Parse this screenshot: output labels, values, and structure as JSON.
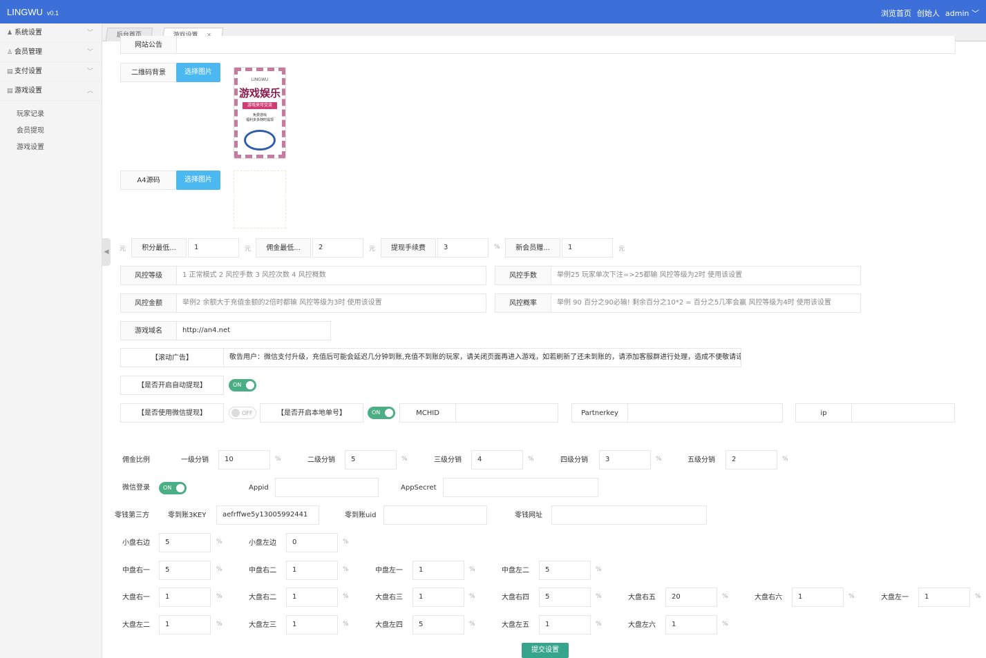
{
  "header": {
    "brand": "LINGWU",
    "version": "v0.1",
    "nav": [
      "浏览首页",
      "创始人",
      "admin"
    ],
    "accent": "#3c6fd8"
  },
  "sidebar": {
    "menus": [
      {
        "label": "系统设置",
        "icon": "person-icon",
        "arrow": "﹀"
      },
      {
        "label": "会员管理",
        "icon": "user-icon",
        "arrow": "﹀"
      },
      {
        "label": "支付设置",
        "icon": "card-icon",
        "arrow": "﹀"
      },
      {
        "label": "游戏设置",
        "icon": "card-icon",
        "arrow": "︿"
      }
    ],
    "submenus": [
      "玩家记录",
      "会员提现",
      "游戏设置"
    ]
  },
  "tabs": {
    "home": "后台首页",
    "game": "游戏设置",
    "close": "×"
  },
  "form": {
    "notice_label": "网站公告",
    "qr_label": "二维码背景",
    "choose_image": "选择图片",
    "a4_label": "A4源码",
    "poster": {
      "brand": "LINGWU",
      "title": "游戏娱乐",
      "banner": "游戏来可交流",
      "line1": "免费游戏",
      "line2": "福利多多随时提现"
    },
    "yuan": "元",
    "percent": "%",
    "min_points_label": "积分最低...",
    "min_points": "1",
    "min_commission_label": "佣金最低...",
    "min_commission": "2",
    "withdraw_fee_label": "提现手续费",
    "withdraw_fee": "3",
    "new_member_label": "新会员赠...",
    "new_member": "1",
    "risk_level_label": "风控等级",
    "risk_level_ph": "1 正常模式 2 风控手数 3 风控次数 4 风控概数",
    "risk_hands_label": "风控手数",
    "risk_hands_ph": "举例25 玩家单次下注=>25都输 风控等级为2时 使用该设置",
    "risk_amount_label": "风控金额",
    "risk_amount_ph": "举例2 余额大于充值金额的2倍时都输 风控等级为3时 使用该设置",
    "risk_prob_label": "风控概率",
    "risk_prob_ph": "举例 90 百分之90必输! 剩余百分之10*2 = 百分之5几率会赢 风控等级为4时 使用该设置",
    "domain_label": "游戏域名",
    "domain": "http://an4.net",
    "scroll_ad_label": "【滚动广告】",
    "scroll_ad": "敬告用户：微信支付升级，充值后可能会延迟几分钟到账,充值不到账的玩家，请关闭页面再进入游戏，如若刷新了还未到账的，请添加客服群进行处理，造成不便敬请谅解",
    "auto_withdraw_label": "【是否开启自动提现】",
    "on": "ON",
    "off": "OFF",
    "wx_withdraw_label": "【是否使用微信提现】",
    "local_order_label": "【是否开启本地单号】",
    "mchid_label": "MCHID",
    "partnerkey_label": "Partnerkey",
    "ip_label": "ip",
    "commission_ratio_label": "佣金比例",
    "levels": [
      {
        "label": "一级分销",
        "value": "10"
      },
      {
        "label": "二级分销",
        "value": "5"
      },
      {
        "label": "三级分销",
        "value": "4"
      },
      {
        "label": "四级分销",
        "value": "3"
      },
      {
        "label": "五级分销",
        "value": "2"
      }
    ],
    "wx_login_label": "微信登录",
    "appid_label": "Appid",
    "appsecret_label": "AppSecret",
    "third_label": "零钱第三方",
    "key_label": "零到账3KEY",
    "key": "aefrffwe5y13005992441",
    "uid_label": "零到账uid",
    "url_label": "零钱网址",
    "small": [
      {
        "label": "小盘右边",
        "value": "5"
      },
      {
        "label": "小盘左边",
        "value": "0"
      }
    ],
    "mid": [
      {
        "label": "中盘右一",
        "value": "5"
      },
      {
        "label": "中盘右二",
        "value": "1"
      },
      {
        "label": "中盘左一",
        "value": "1"
      },
      {
        "label": "中盘左二",
        "value": "5"
      }
    ],
    "big1": [
      {
        "label": "大盘右一",
        "value": "1"
      },
      {
        "label": "大盘右二",
        "value": "1"
      },
      {
        "label": "大盘右三",
        "value": "1"
      },
      {
        "label": "大盘右四",
        "value": "5"
      },
      {
        "label": "大盘右五",
        "value": "20"
      },
      {
        "label": "大盘右六",
        "value": "1"
      },
      {
        "label": "大盘左一",
        "value": "1"
      }
    ],
    "big2": [
      {
        "label": "大盘左二",
        "value": "1"
      },
      {
        "label": "大盘左三",
        "value": "1"
      },
      {
        "label": "大盘左四",
        "value": "5"
      },
      {
        "label": "大盘左五",
        "value": "1"
      },
      {
        "label": "大盘左六",
        "value": "1"
      }
    ],
    "submit": "提交设置"
  }
}
